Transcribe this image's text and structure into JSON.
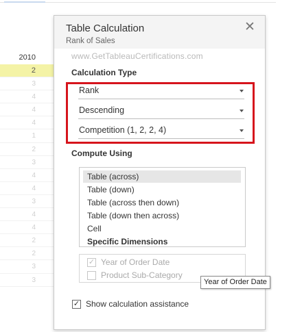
{
  "worksheet": {
    "column_header": "2010",
    "values": [
      "2",
      "3",
      "4",
      "4",
      "4",
      "1",
      "2",
      "3",
      "4",
      "4",
      "3",
      "4",
      "4",
      "2",
      "2",
      "3",
      "3"
    ]
  },
  "dialog": {
    "title": "Table Calculation",
    "subtitle": "Rank of Sales",
    "close_glyph": "✕",
    "watermark": "www.GetTableauCertifications.com",
    "calculation_type": {
      "label": "Calculation Type",
      "type_value": "Rank",
      "order_value": "Descending",
      "rank_method_value": "Competition (1, 2, 2, 4)"
    },
    "compute_using": {
      "label": "Compute Using",
      "options": [
        "Table (across)",
        "Table (down)",
        "Table (across then down)",
        "Table (down then across)",
        "Cell",
        "Specific Dimensions"
      ],
      "selected": "Table (across)"
    },
    "dimensions": [
      {
        "label": "Year of Order Date",
        "checked": true
      },
      {
        "label": "Product Sub-Category",
        "checked": false
      }
    ],
    "show_assistance": {
      "label": "Show calculation assistance",
      "checked": true
    },
    "tooltip": "Year of Order Date"
  },
  "colors": {
    "highlight_red": "#d6141c",
    "highlight_row": "#f4f3a6",
    "selected_item": "#e6e6e6"
  },
  "icons": {
    "close": "close-icon",
    "dropdown": "chevron-down-icon",
    "checkbox": "checkmark-icon"
  }
}
